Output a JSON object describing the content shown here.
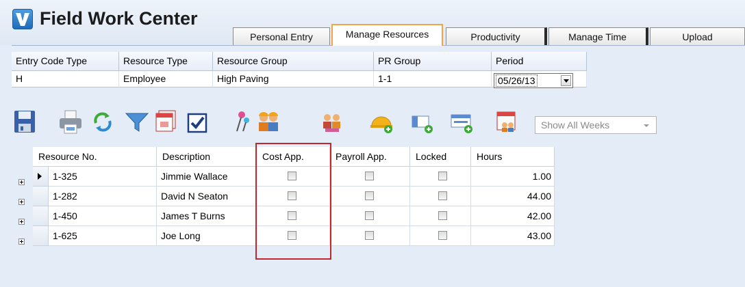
{
  "app": {
    "title": "Field Work Center"
  },
  "tabs": [
    "Personal Entry",
    "Manage Resources",
    "Productivity",
    "Manage Time",
    "Upload"
  ],
  "active_tab": "Manage Resources",
  "filters": {
    "headers": [
      "Entry Code Type",
      "Resource Type",
      "Resource Group",
      "PR Group",
      "Period"
    ],
    "values": {
      "entry_code_type": "H",
      "resource_type": "Employee",
      "resource_group": "High Paving",
      "pr_group": "1-1",
      "period": "05/26/13"
    }
  },
  "toolbar": {
    "icons": [
      "save-icon",
      "print-icon",
      "refresh-icon",
      "filter-icon",
      "calendar-stack-icon",
      "checkmark-icon",
      "pushpin-icon",
      "workers-icon",
      "team-icon",
      "add-hardhat-icon",
      "add-column-icon",
      "add-row-icon",
      "calendar-workers-icon"
    ],
    "show_weeks": "Show All Weeks"
  },
  "grid": {
    "columns": [
      "Resource No.",
      "Description",
      "Cost App.",
      "Payroll App.",
      "Locked",
      "Hours"
    ],
    "rows": [
      {
        "resource_no": "1-325",
        "description": "Jimmie Wallace",
        "cost_app": false,
        "payroll_app": false,
        "locked": false,
        "hours": "1.00"
      },
      {
        "resource_no": "1-282",
        "description": "David N Seaton",
        "cost_app": false,
        "payroll_app": false,
        "locked": false,
        "hours": "44.00"
      },
      {
        "resource_no": "1-450",
        "description": "James T Burns",
        "cost_app": false,
        "payroll_app": false,
        "locked": false,
        "hours": "42.00"
      },
      {
        "resource_no": "1-625",
        "description": "Joe Long",
        "cost_app": false,
        "payroll_app": false,
        "locked": false,
        "hours": "43.00"
      }
    ],
    "highlighted_column": "Cost App."
  },
  "colors": {
    "active_tab_border": "#f0a447",
    "highlight_border": "#c0272d",
    "background": "#e3ecf7"
  }
}
